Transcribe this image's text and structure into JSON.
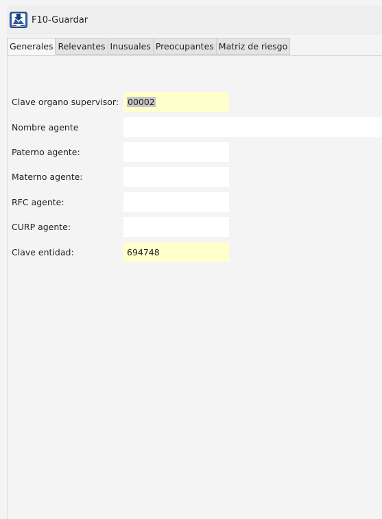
{
  "toolbar": {
    "save_label": "F10-Guardar",
    "save_icon": "save-disk-icon"
  },
  "tabs": [
    {
      "label": "Generales",
      "active": true
    },
    {
      "label": "Relevantes",
      "active": false
    },
    {
      "label": "Inusuales",
      "active": false
    },
    {
      "label": "Preocupantes",
      "active": false
    },
    {
      "label": "Matriz de riesgo",
      "active": false
    }
  ],
  "form": {
    "clave_organo": {
      "label": "Clave organo supervisor:",
      "value": "00002"
    },
    "nombre_agente": {
      "label": "Nombre agente",
      "value": ""
    },
    "paterno_agente": {
      "label": "Paterno agente:",
      "value": ""
    },
    "materno_agente": {
      "label": "Materno agente:",
      "value": ""
    },
    "rfc_agente": {
      "label": "RFC agente:",
      "value": ""
    },
    "curp_agente": {
      "label": "CURP agente:",
      "value": ""
    },
    "clave_entidad": {
      "label": "Clave entidad:",
      "value": "694748"
    }
  },
  "colors": {
    "required_field": "#ffffcc",
    "selection": "#c6c6c6"
  }
}
